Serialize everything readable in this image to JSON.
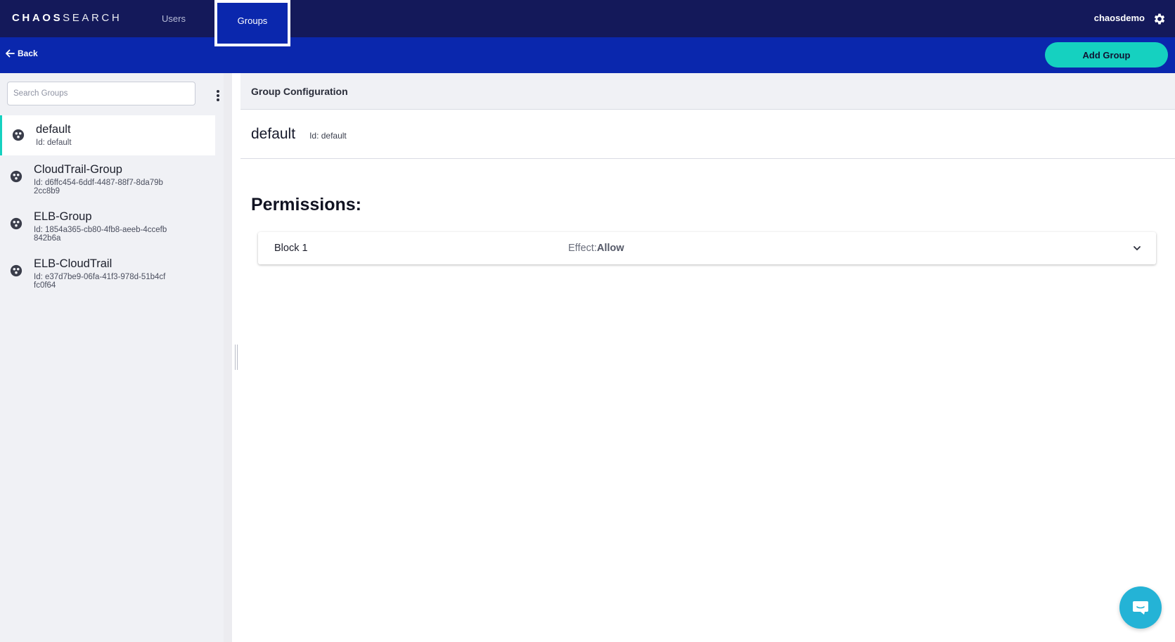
{
  "app": {
    "logo_bold": "CHAOS",
    "logo_light": "SEARCH",
    "nav": {
      "users": "Users",
      "groups": "Groups"
    },
    "username": "chaosdemo"
  },
  "subbar": {
    "back_label": "Back",
    "add_group_label": "Add Group"
  },
  "sidebar": {
    "search_placeholder": "Search Groups",
    "groups": [
      {
        "name": "default",
        "id": "Id: default",
        "active": true
      },
      {
        "name": "CloudTrail-Group",
        "id": "Id: d6ffc454-6ddf-4487-88f7-8da79b2cc8b9",
        "active": false
      },
      {
        "name": "ELB-Group",
        "id": "Id: 1854a365-cb80-4fb8-aeeb-4ccefb842b6a",
        "active": false
      },
      {
        "name": "ELB-CloudTrail",
        "id": "Id: e37d7be9-06fa-41f3-978d-51b4cffc0f64",
        "active": false
      }
    ]
  },
  "main": {
    "header": "Group Configuration",
    "group_name": "default",
    "group_id": "Id: default",
    "permissions_title": "Permissions:",
    "blocks": [
      {
        "name": "Block 1",
        "effect_label": "Effect:",
        "effect_value": "Allow"
      }
    ]
  },
  "colors": {
    "topbar": "#14195a",
    "subbar": "#0a27ad",
    "accent": "#15d1c0",
    "chat": "#24b3d6"
  },
  "icons": {
    "gear": "gear-icon",
    "back": "arrow-left-icon",
    "group": "group-icon",
    "kebab": "more-vertical-icon",
    "chevron": "chevron-down-icon",
    "chat": "chat-icon"
  }
}
